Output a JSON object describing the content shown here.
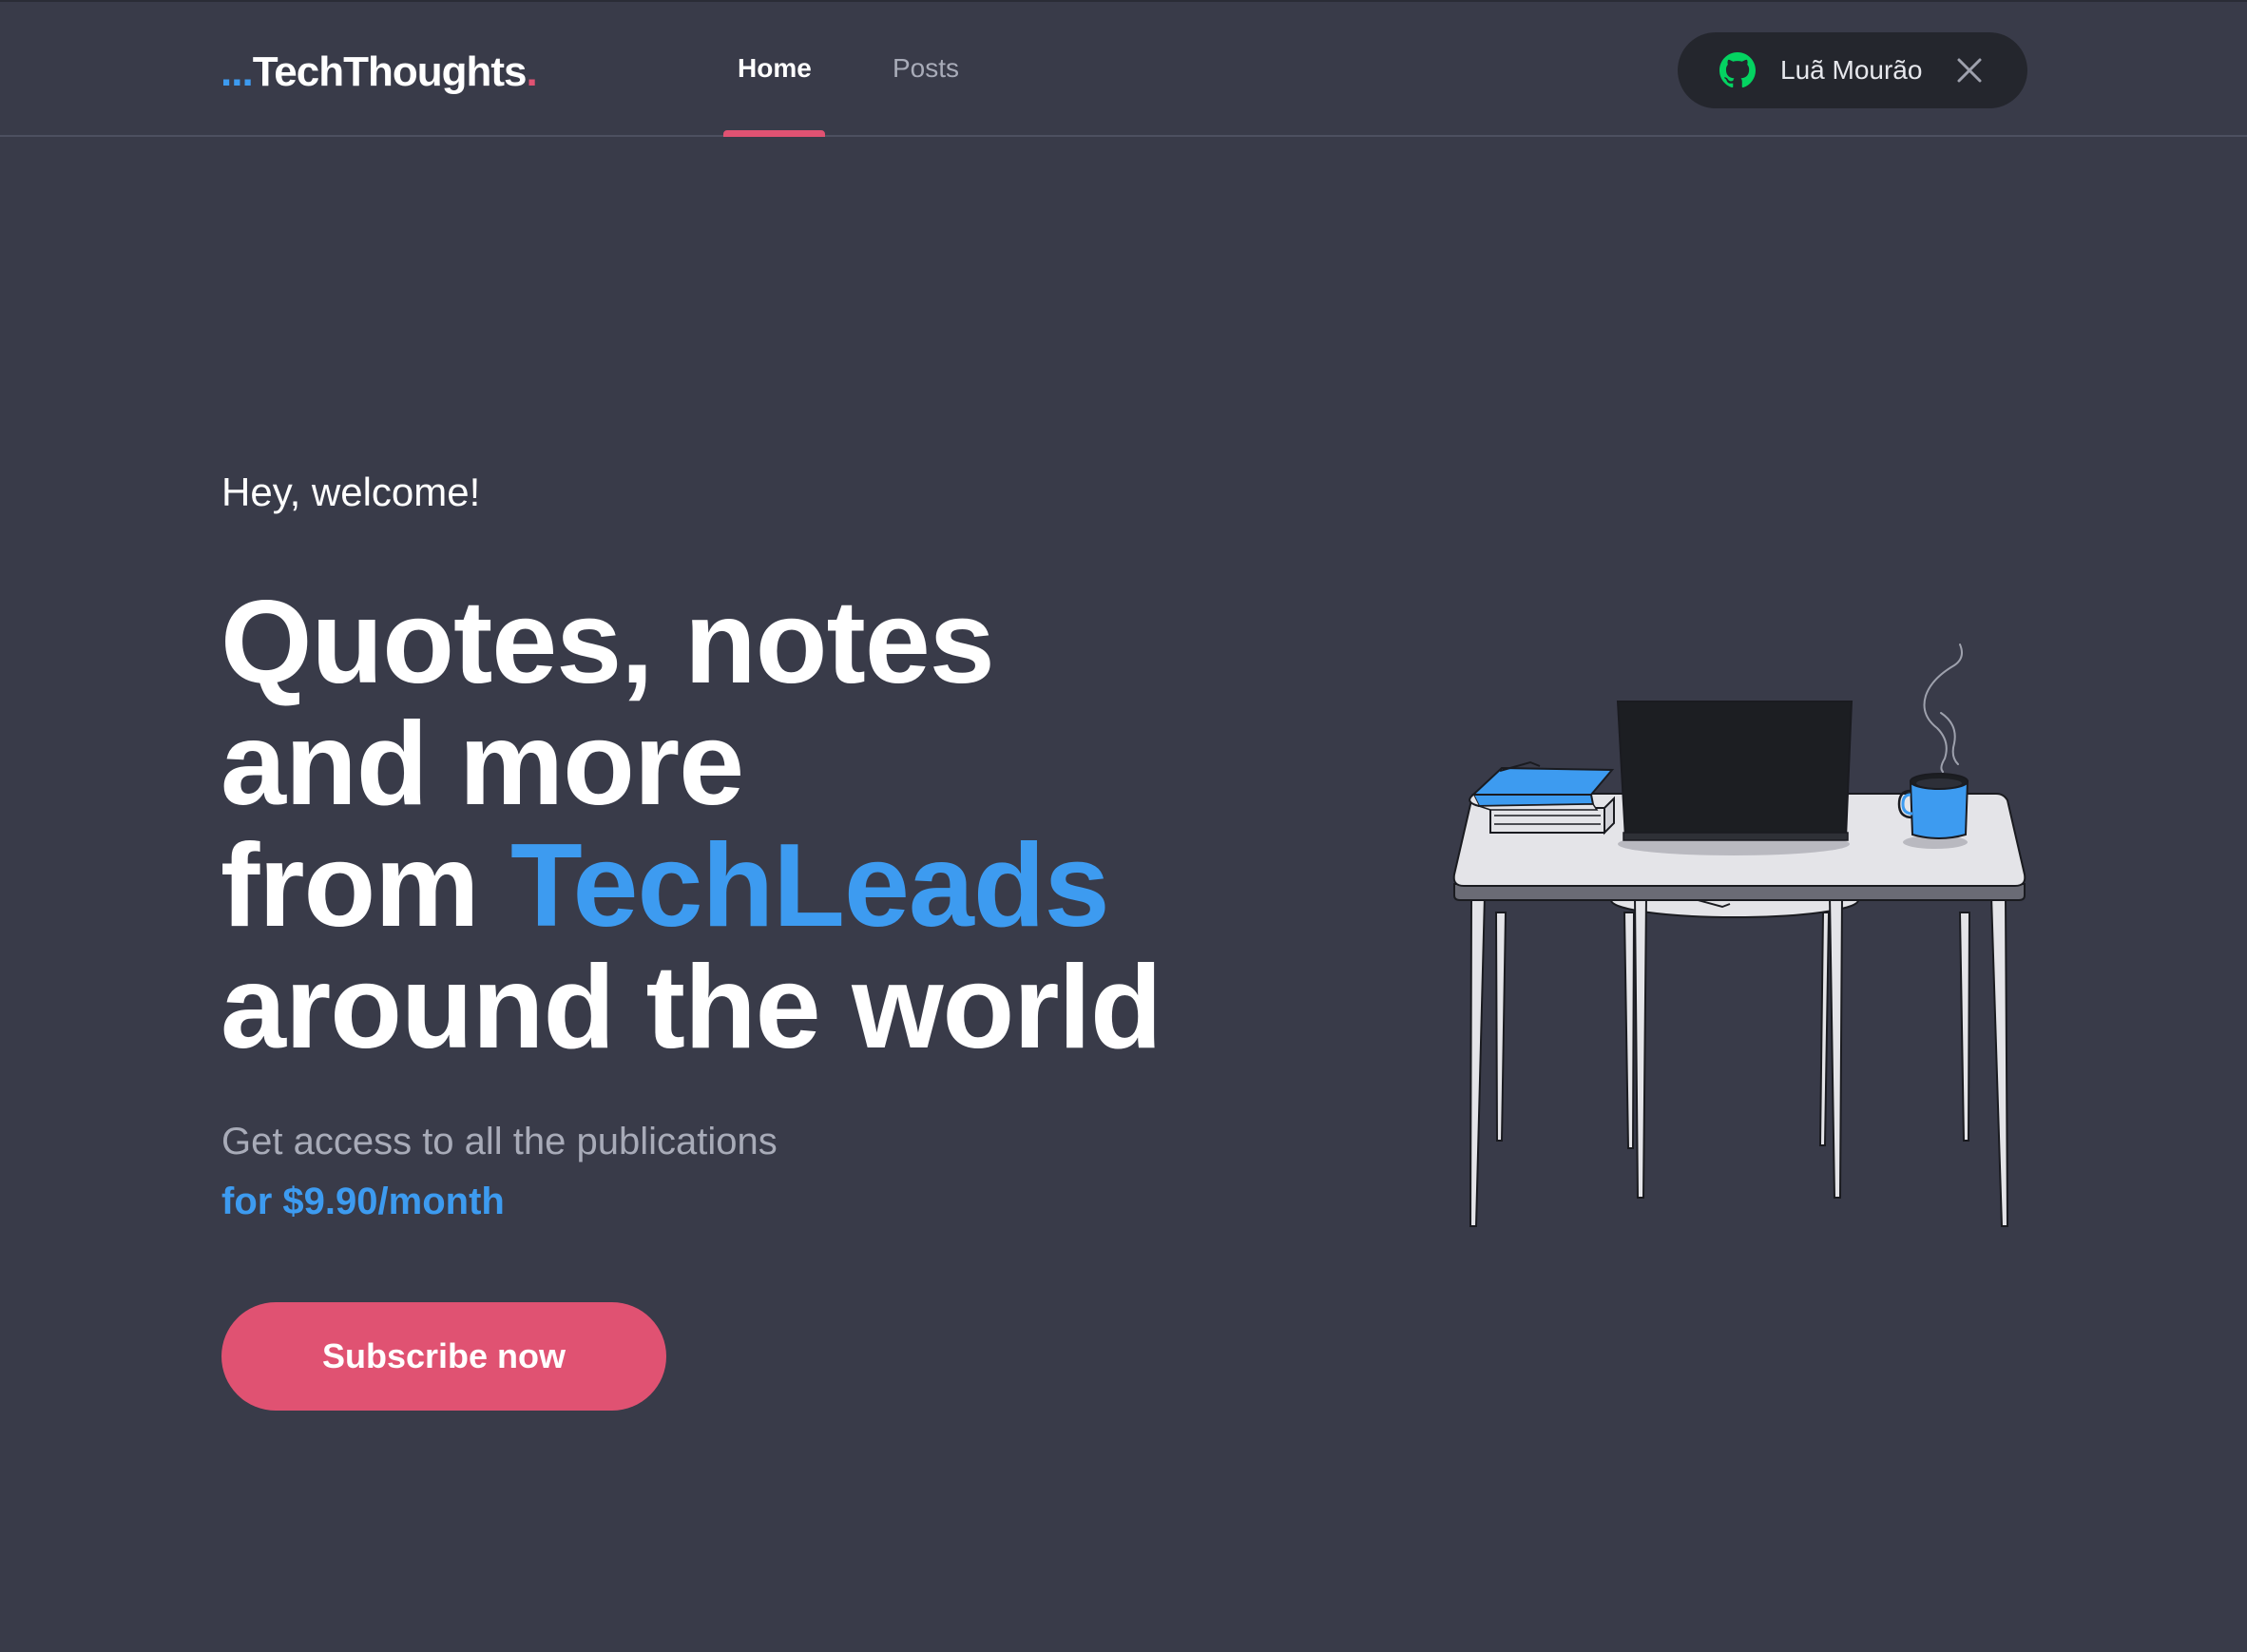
{
  "header": {
    "logo": {
      "prefix": "...",
      "text": "TechThoughts",
      "suffix": "."
    },
    "nav": [
      {
        "label": "Home",
        "active": true
      },
      {
        "label": "Posts",
        "active": false
      }
    ],
    "user": {
      "name": "Luã Mourão",
      "icon": "github-icon",
      "close_icon": "close-icon"
    }
  },
  "hero": {
    "greeting": "Hey, welcome!",
    "headline": {
      "line1": "Quotes, notes",
      "line2": "and more",
      "line3_prefix": "from ",
      "line3_accent": "TechLeads",
      "line4": "around the world"
    },
    "subtitle": "Get access to all the publications",
    "price": "for $9.90/month",
    "cta_label": "Subscribe now",
    "illustration": "desk-with-laptop-books-and-coffee-mug"
  },
  "colors": {
    "background": "#393b49",
    "accent_blue": "#3d9bf0",
    "accent_pink": "#e05272",
    "pill_background": "#24262d",
    "github_green": "#04d361"
  }
}
